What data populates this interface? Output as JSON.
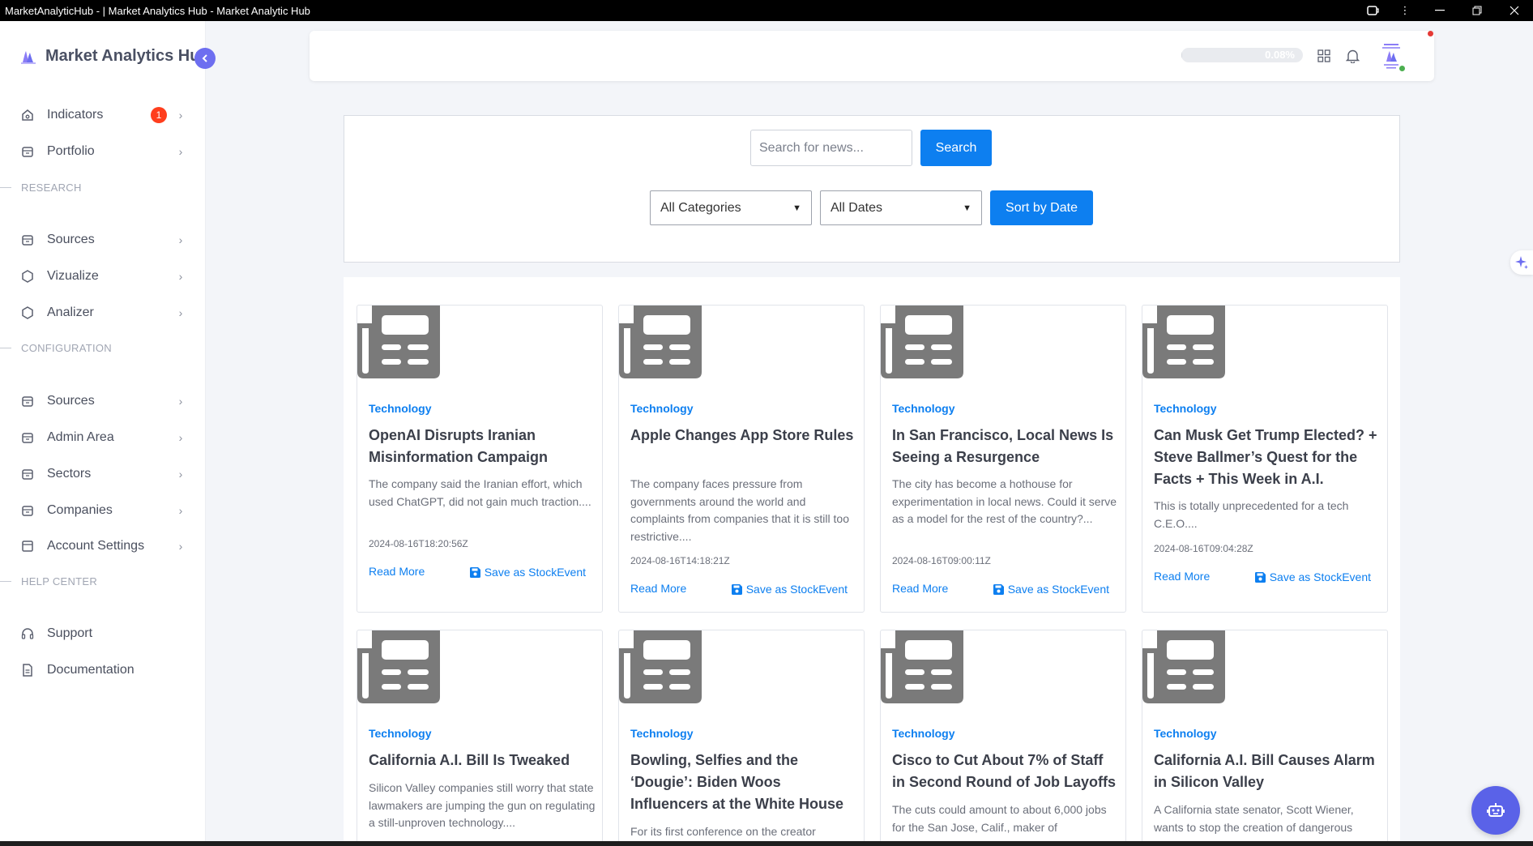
{
  "window": {
    "title": "MarketAnalyticHub - | Market Analytics Hub - Market Analytic Hub"
  },
  "sidebar": {
    "brand": "Market Analytics Hub",
    "top_items": [
      {
        "label": "Indicators",
        "badge": "1",
        "icon": "home-icon"
      },
      {
        "label": "Portfolio",
        "icon": "box-icon"
      }
    ],
    "research_header": "RESEARCH",
    "research_items": [
      {
        "label": "Sources",
        "icon": "box-icon"
      },
      {
        "label": "Vizualize",
        "icon": "hexagon-icon"
      },
      {
        "label": "Analizer",
        "icon": "hexagon-icon"
      }
    ],
    "configuration_header": "CONFIGURATION",
    "configuration_items": [
      {
        "label": "Sources",
        "icon": "box-icon"
      },
      {
        "label": "Admin Area",
        "icon": "box-icon"
      },
      {
        "label": "Sectors",
        "icon": "box-icon"
      },
      {
        "label": "Companies",
        "icon": "box-icon"
      },
      {
        "label": "Account Settings",
        "icon": "window-icon"
      }
    ],
    "help_header": "HELP CENTER",
    "help_items": [
      {
        "label": "Support",
        "icon": "headset-icon"
      },
      {
        "label": "Documentation",
        "icon": "document-icon"
      }
    ]
  },
  "navbar": {
    "progress_text": "0.08%",
    "progress_value": 0.0008
  },
  "search": {
    "placeholder": "Search for news...",
    "search_button": "Search",
    "category_selected": "All Categories",
    "date_selected": "All Dates",
    "sort_button": "Sort by Date"
  },
  "news": [
    {
      "category": "Technology",
      "title": "OpenAI Disrupts Iranian Misinformation Campaign",
      "description": "The company said the Iranian effort, which used ChatGPT, did not gain much traction....",
      "date": "2024-08-16T18:20:56Z",
      "read_more": "Read More",
      "save": "Save as StockEvent"
    },
    {
      "category": "Technology",
      "title": "Apple Changes App Store Rules",
      "description": "The company faces pressure from governments around the world and complaints from companies that it is still too restrictive....",
      "date": "2024-08-16T14:18:21Z",
      "read_more": "Read More",
      "save": "Save as StockEvent"
    },
    {
      "category": "Technology",
      "title": "In San Francisco, Local News Is Seeing a Resurgence",
      "description": "The city has become a hothouse for experimentation in local news. Could it serve as a model for the rest of the country?...",
      "date": "2024-08-16T09:00:11Z",
      "read_more": "Read More",
      "save": "Save as StockEvent"
    },
    {
      "category": "Technology",
      "title": "Can Musk Get Trump Elected? + Steve Ballmer’s Quest for the Facts + This Week in A.I.",
      "description": "This is totally unprecedented for a tech C.E.O....",
      "date": "2024-08-16T09:04:28Z",
      "read_more": "Read More",
      "save": "Save as StockEvent"
    },
    {
      "category": "Technology",
      "title": "California A.I. Bill Is Tweaked",
      "description": "Silicon Valley companies still worry that state lawmakers are jumping the gun on regulating a still-unproven technology....",
      "date": "",
      "read_more": "",
      "save": ""
    },
    {
      "category": "Technology",
      "title": "Bowling, Selfies and the ‘Dougie’: Biden Woos Influencers at the White House",
      "description": "For its first conference on the creator",
      "date": "",
      "read_more": "",
      "save": ""
    },
    {
      "category": "Technology",
      "title": "Cisco to Cut About 7% of Staff in Second Round of Job Layoffs",
      "description": "The cuts could amount to about 6,000 jobs for the San Jose, Calif., maker of",
      "date": "",
      "read_more": "",
      "save": ""
    },
    {
      "category": "Technology",
      "title": "California A.I. Bill Causes Alarm in Silicon Valley",
      "description": "A California state senator, Scott Wiener, wants to stop the creation of dangerous",
      "date": "",
      "read_more": "",
      "save": ""
    }
  ],
  "colors": {
    "accent": "#0d7ff0",
    "brand_purple": "#6d6ef0",
    "badge_red": "#ff3e1d",
    "thumb_gray": "#7a7a7a"
  }
}
